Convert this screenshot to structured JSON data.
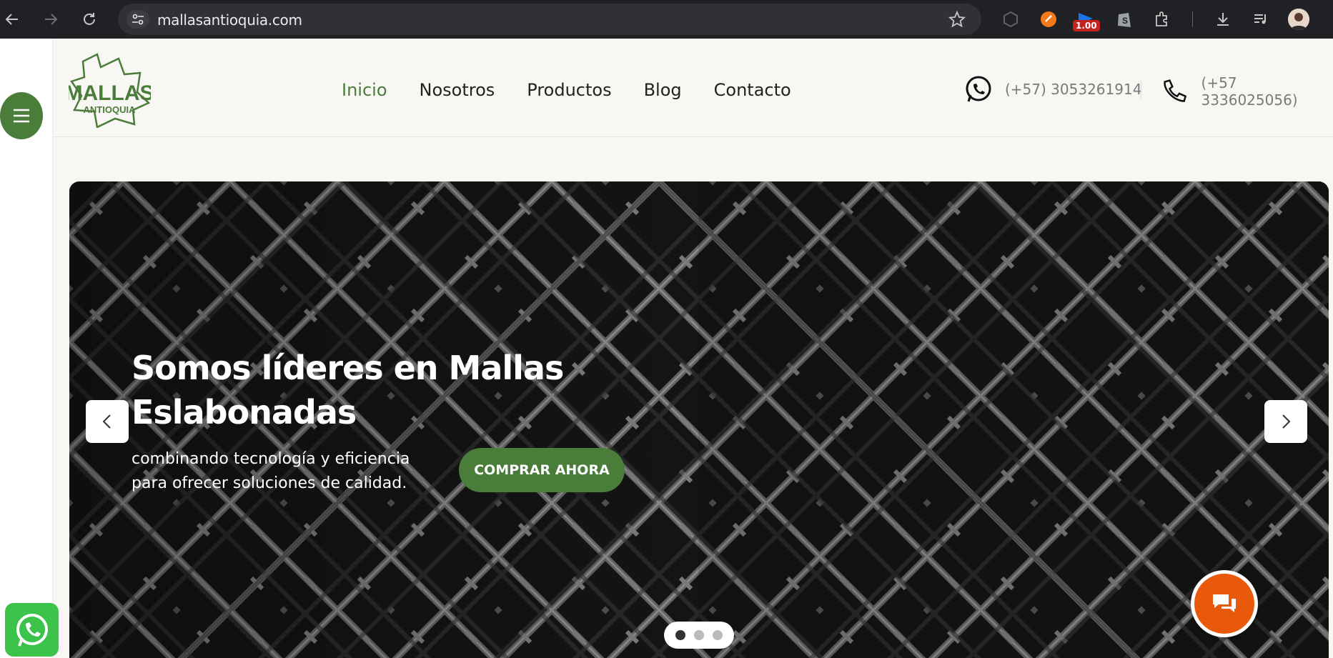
{
  "browser": {
    "url": "mallasantioquia.com",
    "extension_badge": "1.00",
    "icons": [
      "back-icon",
      "forward-icon",
      "reload-icon",
      "site-settings-icon",
      "star-icon",
      "extension-icons",
      "download-icon",
      "media-icon",
      "profile-avatar"
    ]
  },
  "header": {
    "logo_text_top": "MALLAS",
    "logo_text_bottom": "ANTIOQUIA",
    "nav": [
      {
        "label": "Inicio",
        "active": true
      },
      {
        "label": "Nosotros",
        "active": false
      },
      {
        "label": "Productos",
        "active": false
      },
      {
        "label": "Blog",
        "active": false
      },
      {
        "label": "Contacto",
        "active": false
      }
    ],
    "whatsapp_phone": "(+57) 3053261914",
    "phone": "(+57 3336025056)"
  },
  "hero": {
    "title": "Somos líderes en Mallas Eslabonadas",
    "subtitle": "combinando tecnología y eficiencia para ofrecer soluciones de calidad.",
    "cta_label": "COMPRAR AHORA",
    "slide_count": 3,
    "active_slide": 1
  },
  "colors": {
    "brand_green": "#4a7c3a",
    "chat_orange": "#e8590c",
    "whatsapp_green": "#3bc34a",
    "header_bg": "#f8f7f3"
  }
}
